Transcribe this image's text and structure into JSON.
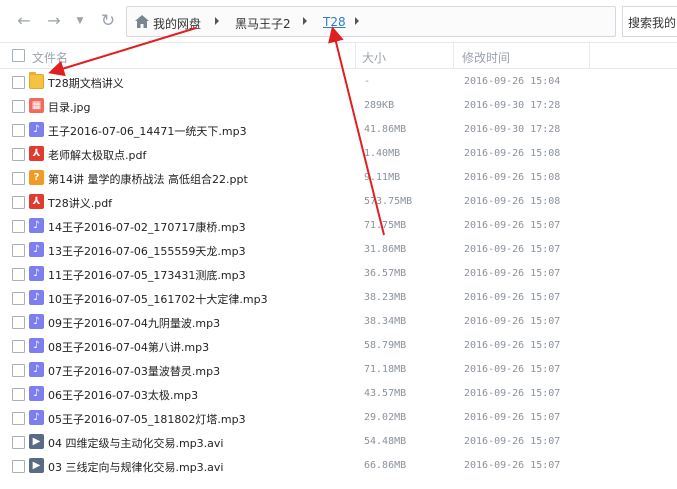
{
  "breadcrumb": {
    "items": [
      "我的网盘",
      "黑马王子2",
      "T28"
    ]
  },
  "search": {
    "placeholder": "搜索我的"
  },
  "columns": {
    "name": "文件名",
    "size": "大小",
    "modified": "修改时间"
  },
  "files": [
    {
      "name": "T28期文档讲义",
      "size": "-",
      "date": "2016-09-26 15:04",
      "type": "folder"
    },
    {
      "name": "目录.jpg",
      "size": "289KB",
      "date": "2016-09-30 17:28",
      "type": "image"
    },
    {
      "name": "王子2016-07-06_14471一统天下.mp3",
      "size": "41.86MB",
      "date": "2016-09-30 17:28",
      "type": "audio"
    },
    {
      "name": "老师解太极取点.pdf",
      "size": "1.40MB",
      "date": "2016-09-26 15:08",
      "type": "pdf"
    },
    {
      "name": "第14讲 量学的康桥战法 高低组合22.ppt",
      "size": "9.11MB",
      "date": "2016-09-26 15:08",
      "type": "ppt"
    },
    {
      "name": "T28讲义.pdf",
      "size": "573.75MB",
      "date": "2016-09-26 15:08",
      "type": "pdf"
    },
    {
      "name": "14王子2016-07-02_170717康桥.mp3",
      "size": "71.75MB",
      "date": "2016-09-26 15:07",
      "type": "audio"
    },
    {
      "name": "13王子2016-07-06_155559天龙.mp3",
      "size": "31.86MB",
      "date": "2016-09-26 15:07",
      "type": "audio"
    },
    {
      "name": "11王子2016-07-05_173431测底.mp3",
      "size": "36.57MB",
      "date": "2016-09-26 15:07",
      "type": "audio"
    },
    {
      "name": "10王子2016-07-05_161702十大定律.mp3",
      "size": "38.23MB",
      "date": "2016-09-26 15:07",
      "type": "audio"
    },
    {
      "name": "09王子2016-07-04九阴量波.mp3",
      "size": "38.34MB",
      "date": "2016-09-26 15:07",
      "type": "audio"
    },
    {
      "name": "08王子2016-07-04第八讲.mp3",
      "size": "58.79MB",
      "date": "2016-09-26 15:07",
      "type": "audio"
    },
    {
      "name": "07王子2016-07-03量波替灵.mp3",
      "size": "71.18MB",
      "date": "2016-09-26 15:07",
      "type": "audio"
    },
    {
      "name": "06王子2016-07-03太极.mp3",
      "size": "43.57MB",
      "date": "2016-09-26 15:07",
      "type": "audio"
    },
    {
      "name": "05王子2016-07-05_181802灯塔.mp3",
      "size": "29.02MB",
      "date": "2016-09-26 15:07",
      "type": "audio"
    },
    {
      "name": "04 四维定级与主动化交易.mp3.avi",
      "size": "54.48MB",
      "date": "2016-09-26 15:07",
      "type": "video"
    },
    {
      "name": "03 三线定向与规律化交易.mp3.avi",
      "size": "66.86MB",
      "date": "2016-09-26 15:07",
      "type": "video"
    }
  ],
  "icons": {
    "folder": "folder-icon",
    "image": "image-file-icon",
    "audio": "audio-file-icon",
    "pdf": "pdf-file-icon",
    "ppt": "ppt-file-icon",
    "video": "video-file-icon"
  },
  "colors": {
    "annotation_arrow": "#e02020",
    "link": "#2b7fd2"
  }
}
